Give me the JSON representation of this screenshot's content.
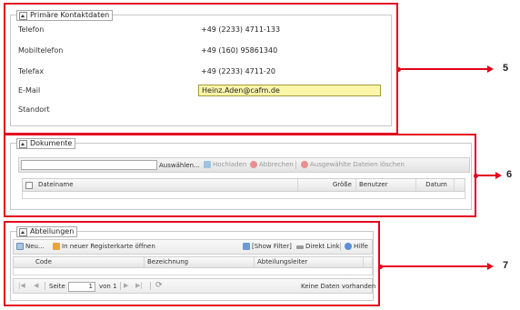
{
  "contact": {
    "legend": "Primäre Kontaktdaten",
    "rows": [
      {
        "label": "Telefon",
        "value": "+49 (2233) 4711-133"
      },
      {
        "label": "Mobiltelefon",
        "value": "+49 (160) 95861340"
      },
      {
        "label": "Telefax",
        "value": "+49 (2233) 4711-20"
      },
      {
        "label": "E-Mail",
        "value": "Heinz.Aden@cafm.de"
      },
      {
        "label": "Standort",
        "value": ""
      }
    ]
  },
  "documents": {
    "legend": "Dokumente",
    "toolbar": {
      "choose": "Auswählen...",
      "upload": "Hochladen",
      "cancel": "Abbrechen",
      "delete_selected": "Ausgewählte Dateien löschen"
    },
    "columns": [
      "Dateiname",
      "Größe",
      "Benutzer",
      "Datum"
    ]
  },
  "departments": {
    "legend": "Abteilungen",
    "toolbar": {
      "new": "Neu...",
      "open_tab": "In neuer Registerkarte öffnen",
      "show_filter": "[Show Filter]",
      "direct_link": "Direkt Link",
      "help": "Hilfe"
    },
    "columns": [
      "Code",
      "Bezeichnung",
      "Abteilungsleiter"
    ],
    "pager": {
      "page_label": "Seite",
      "page_value": "1",
      "of_label": "von 1",
      "empty_text": "Keine Daten vorhanden"
    }
  },
  "callouts": [
    "5",
    "6",
    "7"
  ],
  "colors": {
    "highlight": "#e3001b",
    "email_bg": "#fbf6a8"
  }
}
